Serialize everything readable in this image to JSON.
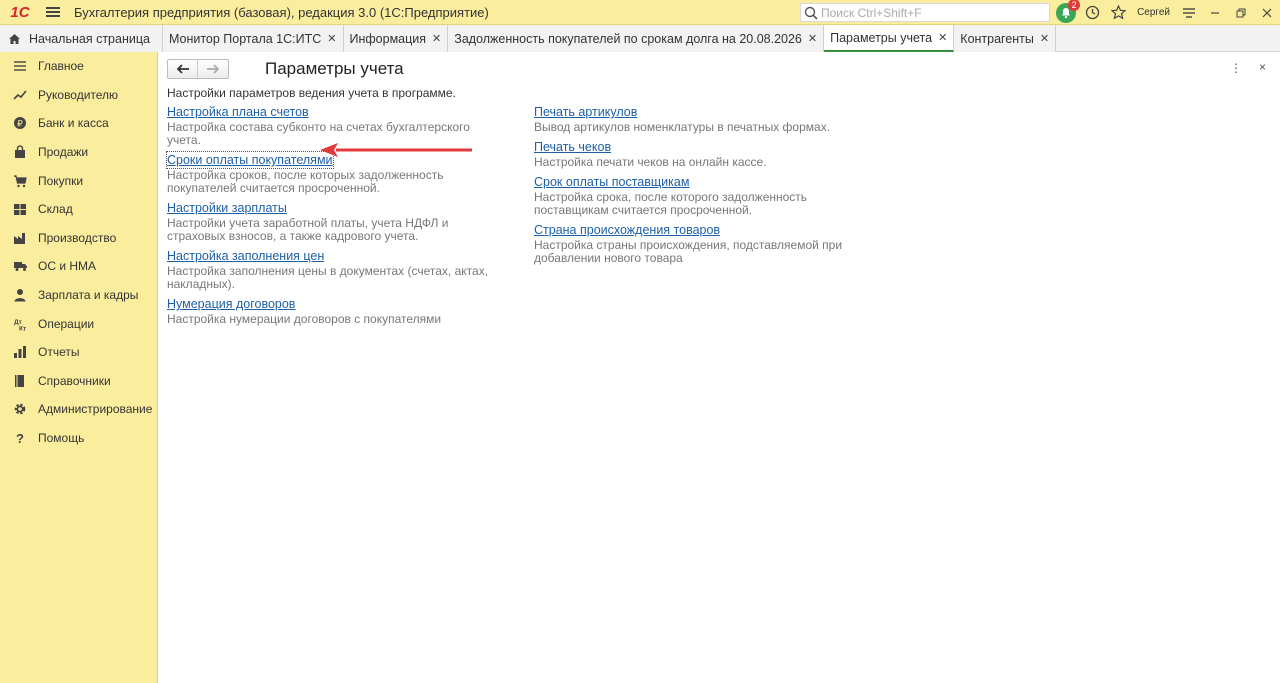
{
  "window": {
    "logo": "1С",
    "title": "Бухгалтерия предприятия (базовая), редакция 3.0  (1С:Предприятие)",
    "search_placeholder": "Поиск Ctrl+Shift+F",
    "notifications_count": "2",
    "user": "Сергей"
  },
  "tabs": [
    {
      "label": "Начальная страница",
      "closable": false
    },
    {
      "label": "Монитор Портала 1С:ИТС",
      "closable": true
    },
    {
      "label": "Информация",
      "closable": true
    },
    {
      "label": "Задолженность покупателей по срокам долга на 20.08.2026",
      "closable": true
    },
    {
      "label": "Параметры учета",
      "closable": true,
      "active": true
    },
    {
      "label": "Контрагенты",
      "closable": true
    }
  ],
  "sidebar": {
    "items": [
      {
        "label": "Главное",
        "icon": "menu-lines-icon"
      },
      {
        "label": "Руководителю",
        "icon": "trend-icon"
      },
      {
        "label": "Банк и касса",
        "icon": "coin-icon"
      },
      {
        "label": "Продажи",
        "icon": "bag-icon"
      },
      {
        "label": "Покупки",
        "icon": "cart-icon"
      },
      {
        "label": "Склад",
        "icon": "warehouse-icon"
      },
      {
        "label": "Производство",
        "icon": "factory-icon"
      },
      {
        "label": "ОС и НМА",
        "icon": "truck-icon"
      },
      {
        "label": "Зарплата и кадры",
        "icon": "person-icon"
      },
      {
        "label": "Операции",
        "icon": "dt-kt-icon"
      },
      {
        "label": "Отчеты",
        "icon": "chart-icon"
      },
      {
        "label": "Справочники",
        "icon": "book-icon"
      },
      {
        "label": "Администрирование",
        "icon": "gear-icon"
      },
      {
        "label": "Помощь",
        "icon": "question-icon"
      }
    ]
  },
  "main": {
    "title": "Параметры учета",
    "intro": "Настройки параметров ведения учета в программе.",
    "more": "⋮",
    "close": "×",
    "left_items": [
      {
        "link": "Настройка плана счетов",
        "desc": "Настройка состава субконто на счетах бухгалтерского учета."
      },
      {
        "link": "Сроки оплаты покупателями",
        "desc": "Настройка сроков, после которых задолженность покупателей считается просроченной."
      },
      {
        "link": "Настройки зарплаты",
        "desc": "Настройки учета заработной платы, учета НДФЛ и страховых взносов, а также кадрового учета."
      },
      {
        "link": "Настройка заполнения цен",
        "desc": "Настройка заполнения цены в документах (счетах, актах, накладных)."
      },
      {
        "link": "Нумерация договоров",
        "desc": "Настройка нумерации договоров с покупателями"
      }
    ],
    "right_items": [
      {
        "link": "Печать артикулов",
        "desc": "Вывод артикулов номенклатуры в печатных формах."
      },
      {
        "link": "Печать чеков",
        "desc": "Настройка печати чеков на онлайн кассе."
      },
      {
        "link": "Срок оплаты поставщикам",
        "desc": "Настройка срока, после которого задолженность поставщикам считается просроченной."
      },
      {
        "link": "Страна происхождения товаров",
        "desc": "Настройка страны происхождения, подставляемой при добавлении нового товара"
      }
    ]
  },
  "colors": {
    "panel_yellow": "#fbed9e",
    "link_blue": "#1d5fa6",
    "annotation_red": "#e03a3a",
    "active_tab_green": "#3b8d3b"
  }
}
